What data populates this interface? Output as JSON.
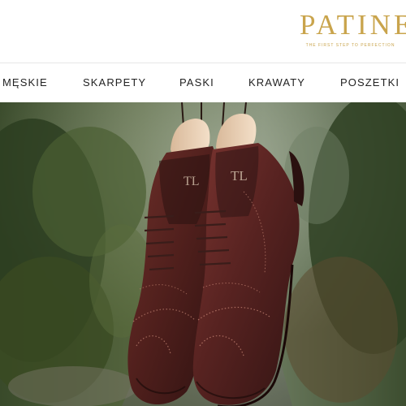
{
  "brand": {
    "name": "PATINE",
    "tagline": "THE FIRST STEP TO PERFECTION",
    "accent_color": "#c9a44c"
  },
  "nav": {
    "items": [
      {
        "label": "MĘSKIE"
      },
      {
        "label": "SKARPETY"
      },
      {
        "label": "PASKI"
      },
      {
        "label": "KRAWATY"
      },
      {
        "label": "POSZETKI"
      }
    ]
  },
  "hero": {
    "subject": "pair of brown brogue oxford shoes with wooden shoe trees",
    "shoe_tree_imprint": "TL"
  }
}
